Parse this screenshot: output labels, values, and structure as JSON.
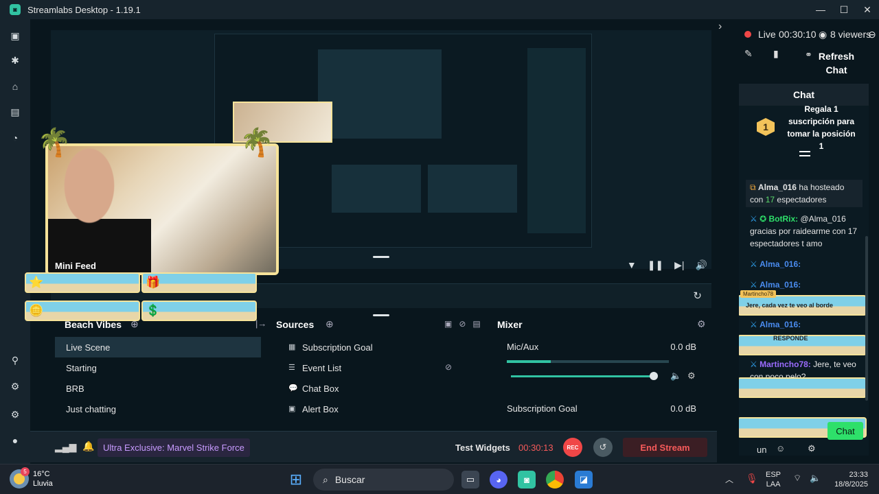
{
  "window": {
    "title": "Streamlabs Desktop - 1.19.1",
    "min": "—",
    "max": "☐",
    "close": "✕"
  },
  "sidebar": {
    "icons": [
      "editor-icon",
      "themes-icon",
      "store-icon",
      "layout-icon",
      "dashboard-icon",
      "alerts-icon",
      "tools-icon",
      "settings-icon",
      "profile-icon"
    ]
  },
  "preview": {
    "minifeed": {
      "title": "Mini Feed"
    },
    "collapse": "›"
  },
  "scenes": {
    "title": "Beach Vibes",
    "items": [
      {
        "label": "Live Scene",
        "active": true
      },
      {
        "label": "Starting"
      },
      {
        "label": "BRB"
      },
      {
        "label": "Just chatting"
      }
    ]
  },
  "sources": {
    "title": "Sources",
    "items": [
      {
        "label": "Subscription Goal",
        "icon": "▦"
      },
      {
        "label": "Event List",
        "icon": "☰"
      },
      {
        "label": "Chat Box",
        "icon": "💬"
      },
      {
        "label": "Alert Box",
        "icon": "▣"
      }
    ]
  },
  "mixer": {
    "title": "Mixer",
    "items": [
      {
        "label": "Mic/Aux",
        "db": "0.0 dB",
        "level": 0.27
      },
      {
        "label": "Subscription Goal",
        "db": "0.0 dB"
      }
    ]
  },
  "bottom": {
    "promo": "Ultra Exclusive: Marvel Strike Force",
    "test_widgets": "Test Widgets",
    "timer": "00:30:13",
    "rec": "REC",
    "end_stream": "End Stream"
  },
  "right": {
    "live_label": "Live",
    "live_time": "00:30:10",
    "viewers": "8 viewers",
    "refresh_chat": "Refresh Chat",
    "chat_title": "Chat",
    "top_msg": "Regala 1 suscripción para tomar la posición",
    "top_msg_rank": "1",
    "top_msg_position": "1",
    "host_user": "Alma_016",
    "host_text_a": "ha hosteado con",
    "host_count": "17",
    "host_text_b": "espectadores",
    "bot_name": "BotRix:",
    "bot_text": "@Alma_016 gracias por raidearme con 17 espectadores t amo",
    "user1": "Alma_016:",
    "user2": "Alma_016:",
    "user3": "Alma_016:",
    "alert1_name": "Martincho78",
    "alert1_text": "Jere, cada vez te veo al borde",
    "alert2_text": "RESPONDE",
    "martin_name": "Martincho78:",
    "martin_text": "Jere, te veo con poco pelo?",
    "input_value": "un",
    "chat_button": "Chat"
  },
  "taskbar": {
    "temp": "16°C",
    "weather": "Lluvia",
    "weather_badge": "5",
    "search": "Buscar",
    "lang": "ESP",
    "lang2": "LAA",
    "time": "23:33",
    "date": "18/8/2025"
  }
}
